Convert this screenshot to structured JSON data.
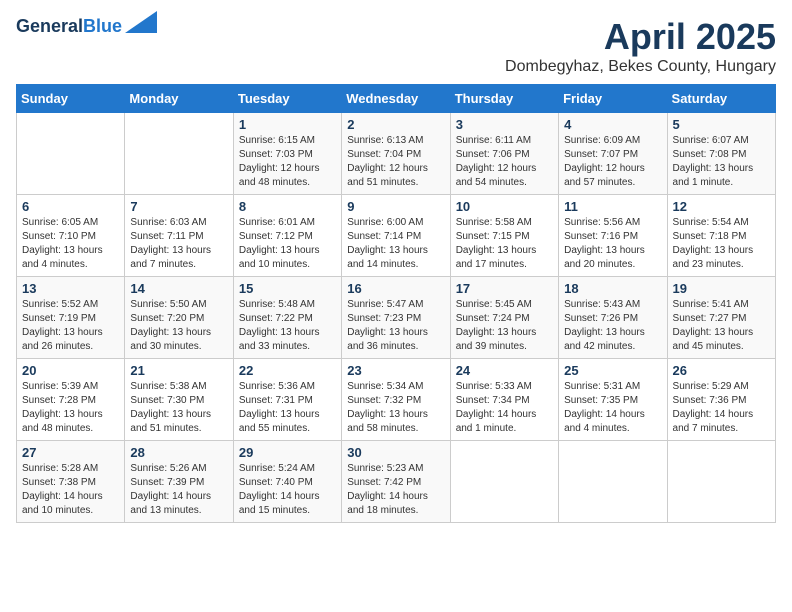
{
  "header": {
    "logo_general": "General",
    "logo_blue": "Blue",
    "month_title": "April 2025",
    "location": "Dombegyhaz, Bekes County, Hungary"
  },
  "days_of_week": [
    "Sunday",
    "Monday",
    "Tuesday",
    "Wednesday",
    "Thursday",
    "Friday",
    "Saturday"
  ],
  "weeks": [
    [
      {
        "day": "",
        "detail": ""
      },
      {
        "day": "",
        "detail": ""
      },
      {
        "day": "1",
        "detail": "Sunrise: 6:15 AM\nSunset: 7:03 PM\nDaylight: 12 hours\nand 48 minutes."
      },
      {
        "day": "2",
        "detail": "Sunrise: 6:13 AM\nSunset: 7:04 PM\nDaylight: 12 hours\nand 51 minutes."
      },
      {
        "day": "3",
        "detail": "Sunrise: 6:11 AM\nSunset: 7:06 PM\nDaylight: 12 hours\nand 54 minutes."
      },
      {
        "day": "4",
        "detail": "Sunrise: 6:09 AM\nSunset: 7:07 PM\nDaylight: 12 hours\nand 57 minutes."
      },
      {
        "day": "5",
        "detail": "Sunrise: 6:07 AM\nSunset: 7:08 PM\nDaylight: 13 hours\nand 1 minute."
      }
    ],
    [
      {
        "day": "6",
        "detail": "Sunrise: 6:05 AM\nSunset: 7:10 PM\nDaylight: 13 hours\nand 4 minutes."
      },
      {
        "day": "7",
        "detail": "Sunrise: 6:03 AM\nSunset: 7:11 PM\nDaylight: 13 hours\nand 7 minutes."
      },
      {
        "day": "8",
        "detail": "Sunrise: 6:01 AM\nSunset: 7:12 PM\nDaylight: 13 hours\nand 10 minutes."
      },
      {
        "day": "9",
        "detail": "Sunrise: 6:00 AM\nSunset: 7:14 PM\nDaylight: 13 hours\nand 14 minutes."
      },
      {
        "day": "10",
        "detail": "Sunrise: 5:58 AM\nSunset: 7:15 PM\nDaylight: 13 hours\nand 17 minutes."
      },
      {
        "day": "11",
        "detail": "Sunrise: 5:56 AM\nSunset: 7:16 PM\nDaylight: 13 hours\nand 20 minutes."
      },
      {
        "day": "12",
        "detail": "Sunrise: 5:54 AM\nSunset: 7:18 PM\nDaylight: 13 hours\nand 23 minutes."
      }
    ],
    [
      {
        "day": "13",
        "detail": "Sunrise: 5:52 AM\nSunset: 7:19 PM\nDaylight: 13 hours\nand 26 minutes."
      },
      {
        "day": "14",
        "detail": "Sunrise: 5:50 AM\nSunset: 7:20 PM\nDaylight: 13 hours\nand 30 minutes."
      },
      {
        "day": "15",
        "detail": "Sunrise: 5:48 AM\nSunset: 7:22 PM\nDaylight: 13 hours\nand 33 minutes."
      },
      {
        "day": "16",
        "detail": "Sunrise: 5:47 AM\nSunset: 7:23 PM\nDaylight: 13 hours\nand 36 minutes."
      },
      {
        "day": "17",
        "detail": "Sunrise: 5:45 AM\nSunset: 7:24 PM\nDaylight: 13 hours\nand 39 minutes."
      },
      {
        "day": "18",
        "detail": "Sunrise: 5:43 AM\nSunset: 7:26 PM\nDaylight: 13 hours\nand 42 minutes."
      },
      {
        "day": "19",
        "detail": "Sunrise: 5:41 AM\nSunset: 7:27 PM\nDaylight: 13 hours\nand 45 minutes."
      }
    ],
    [
      {
        "day": "20",
        "detail": "Sunrise: 5:39 AM\nSunset: 7:28 PM\nDaylight: 13 hours\nand 48 minutes."
      },
      {
        "day": "21",
        "detail": "Sunrise: 5:38 AM\nSunset: 7:30 PM\nDaylight: 13 hours\nand 51 minutes."
      },
      {
        "day": "22",
        "detail": "Sunrise: 5:36 AM\nSunset: 7:31 PM\nDaylight: 13 hours\nand 55 minutes."
      },
      {
        "day": "23",
        "detail": "Sunrise: 5:34 AM\nSunset: 7:32 PM\nDaylight: 13 hours\nand 58 minutes."
      },
      {
        "day": "24",
        "detail": "Sunrise: 5:33 AM\nSunset: 7:34 PM\nDaylight: 14 hours\nand 1 minute."
      },
      {
        "day": "25",
        "detail": "Sunrise: 5:31 AM\nSunset: 7:35 PM\nDaylight: 14 hours\nand 4 minutes."
      },
      {
        "day": "26",
        "detail": "Sunrise: 5:29 AM\nSunset: 7:36 PM\nDaylight: 14 hours\nand 7 minutes."
      }
    ],
    [
      {
        "day": "27",
        "detail": "Sunrise: 5:28 AM\nSunset: 7:38 PM\nDaylight: 14 hours\nand 10 minutes."
      },
      {
        "day": "28",
        "detail": "Sunrise: 5:26 AM\nSunset: 7:39 PM\nDaylight: 14 hours\nand 13 minutes."
      },
      {
        "day": "29",
        "detail": "Sunrise: 5:24 AM\nSunset: 7:40 PM\nDaylight: 14 hours\nand 15 minutes."
      },
      {
        "day": "30",
        "detail": "Sunrise: 5:23 AM\nSunset: 7:42 PM\nDaylight: 14 hours\nand 18 minutes."
      },
      {
        "day": "",
        "detail": ""
      },
      {
        "day": "",
        "detail": ""
      },
      {
        "day": "",
        "detail": ""
      }
    ]
  ]
}
